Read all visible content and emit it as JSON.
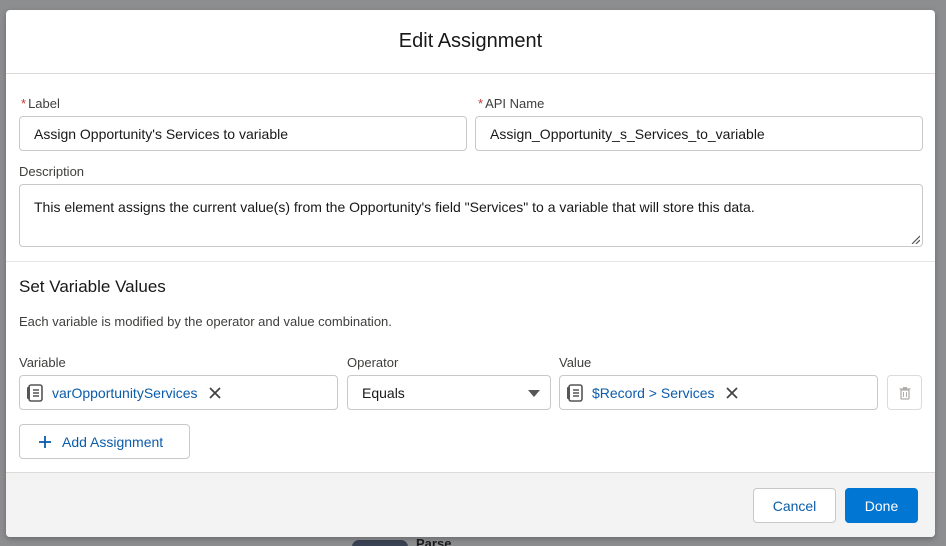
{
  "modal": {
    "title": "Edit Assignment"
  },
  "form": {
    "label_field": {
      "label": "Label",
      "required_mark": "*",
      "value": "Assign Opportunity's Services to variable"
    },
    "api_name_field": {
      "label": "API Name",
      "required_mark": "*",
      "value": "Assign_Opportunity_s_Services_to_variable"
    },
    "description_field": {
      "label": "Description",
      "value": "This element assigns the current value(s) from the Opportunity's field \"Services\" to a variable that will store this data."
    }
  },
  "variables": {
    "section_title": "Set Variable Values",
    "help_text": "Each variable is modified by the operator and value combination.",
    "column_variable": "Variable",
    "column_operator": "Operator",
    "column_value": "Value",
    "rows": [
      {
        "variable": "varOpportunityServices",
        "operator": "Equals",
        "value": "$Record > Services"
      }
    ],
    "add_label": "Add Assignment"
  },
  "footer": {
    "cancel_label": "Cancel",
    "done_label": "Done"
  },
  "background": {
    "node_label": "Parse"
  },
  "icons": {
    "resource": "resource-list-icon",
    "remove": "close-icon",
    "trash": "trash-icon",
    "add": "plus-icon"
  },
  "colors": {
    "brand": "#0176d3",
    "link": "#0b5cab",
    "required": "#c23934"
  }
}
